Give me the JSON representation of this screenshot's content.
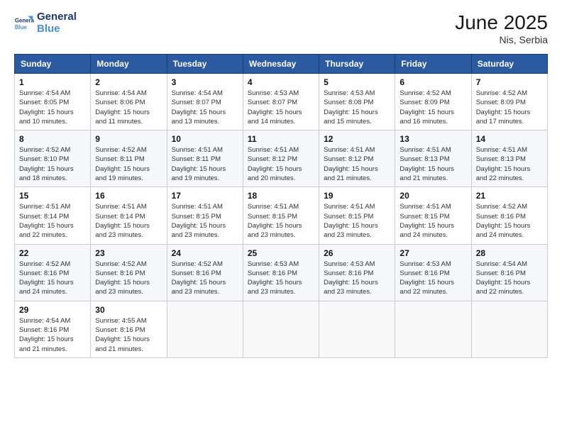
{
  "logo": {
    "line1": "General",
    "line2": "Blue"
  },
  "title": "June 2025",
  "location": "Nis, Serbia",
  "weekdays": [
    "Sunday",
    "Monday",
    "Tuesday",
    "Wednesday",
    "Thursday",
    "Friday",
    "Saturday"
  ],
  "weeks": [
    [
      {
        "day": "1",
        "sunrise": "4:54 AM",
        "sunset": "8:05 PM",
        "daylight": "15 hours and 10 minutes."
      },
      {
        "day": "2",
        "sunrise": "4:54 AM",
        "sunset": "8:06 PM",
        "daylight": "15 hours and 11 minutes."
      },
      {
        "day": "3",
        "sunrise": "4:54 AM",
        "sunset": "8:07 PM",
        "daylight": "15 hours and 13 minutes."
      },
      {
        "day": "4",
        "sunrise": "4:53 AM",
        "sunset": "8:07 PM",
        "daylight": "15 hours and 14 minutes."
      },
      {
        "day": "5",
        "sunrise": "4:53 AM",
        "sunset": "8:08 PM",
        "daylight": "15 hours and 15 minutes."
      },
      {
        "day": "6",
        "sunrise": "4:52 AM",
        "sunset": "8:09 PM",
        "daylight": "15 hours and 16 minutes."
      },
      {
        "day": "7",
        "sunrise": "4:52 AM",
        "sunset": "8:09 PM",
        "daylight": "15 hours and 17 minutes."
      }
    ],
    [
      {
        "day": "8",
        "sunrise": "4:52 AM",
        "sunset": "8:10 PM",
        "daylight": "15 hours and 18 minutes."
      },
      {
        "day": "9",
        "sunrise": "4:52 AM",
        "sunset": "8:11 PM",
        "daylight": "15 hours and 19 minutes."
      },
      {
        "day": "10",
        "sunrise": "4:51 AM",
        "sunset": "8:11 PM",
        "daylight": "15 hours and 19 minutes."
      },
      {
        "day": "11",
        "sunrise": "4:51 AM",
        "sunset": "8:12 PM",
        "daylight": "15 hours and 20 minutes."
      },
      {
        "day": "12",
        "sunrise": "4:51 AM",
        "sunset": "8:12 PM",
        "daylight": "15 hours and 21 minutes."
      },
      {
        "day": "13",
        "sunrise": "4:51 AM",
        "sunset": "8:13 PM",
        "daylight": "15 hours and 21 minutes."
      },
      {
        "day": "14",
        "sunrise": "4:51 AM",
        "sunset": "8:13 PM",
        "daylight": "15 hours and 22 minutes."
      }
    ],
    [
      {
        "day": "15",
        "sunrise": "4:51 AM",
        "sunset": "8:14 PM",
        "daylight": "15 hours and 22 minutes."
      },
      {
        "day": "16",
        "sunrise": "4:51 AM",
        "sunset": "8:14 PM",
        "daylight": "15 hours and 23 minutes."
      },
      {
        "day": "17",
        "sunrise": "4:51 AM",
        "sunset": "8:15 PM",
        "daylight": "15 hours and 23 minutes."
      },
      {
        "day": "18",
        "sunrise": "4:51 AM",
        "sunset": "8:15 PM",
        "daylight": "15 hours and 23 minutes."
      },
      {
        "day": "19",
        "sunrise": "4:51 AM",
        "sunset": "8:15 PM",
        "daylight": "15 hours and 23 minutes."
      },
      {
        "day": "20",
        "sunrise": "4:51 AM",
        "sunset": "8:15 PM",
        "daylight": "15 hours and 24 minutes."
      },
      {
        "day": "21",
        "sunrise": "4:52 AM",
        "sunset": "8:16 PM",
        "daylight": "15 hours and 24 minutes."
      }
    ],
    [
      {
        "day": "22",
        "sunrise": "4:52 AM",
        "sunset": "8:16 PM",
        "daylight": "15 hours and 24 minutes."
      },
      {
        "day": "23",
        "sunrise": "4:52 AM",
        "sunset": "8:16 PM",
        "daylight": "15 hours and 23 minutes."
      },
      {
        "day": "24",
        "sunrise": "4:52 AM",
        "sunset": "8:16 PM",
        "daylight": "15 hours and 23 minutes."
      },
      {
        "day": "25",
        "sunrise": "4:53 AM",
        "sunset": "8:16 PM",
        "daylight": "15 hours and 23 minutes."
      },
      {
        "day": "26",
        "sunrise": "4:53 AM",
        "sunset": "8:16 PM",
        "daylight": "15 hours and 23 minutes."
      },
      {
        "day": "27",
        "sunrise": "4:53 AM",
        "sunset": "8:16 PM",
        "daylight": "15 hours and 22 minutes."
      },
      {
        "day": "28",
        "sunrise": "4:54 AM",
        "sunset": "8:16 PM",
        "daylight": "15 hours and 22 minutes."
      }
    ],
    [
      {
        "day": "29",
        "sunrise": "4:54 AM",
        "sunset": "8:16 PM",
        "daylight": "15 hours and 21 minutes."
      },
      {
        "day": "30",
        "sunrise": "4:55 AM",
        "sunset": "8:16 PM",
        "daylight": "15 hours and 21 minutes."
      },
      null,
      null,
      null,
      null,
      null
    ]
  ],
  "labels": {
    "sunrise": "Sunrise:",
    "sunset": "Sunset:",
    "daylight": "Daylight:"
  }
}
